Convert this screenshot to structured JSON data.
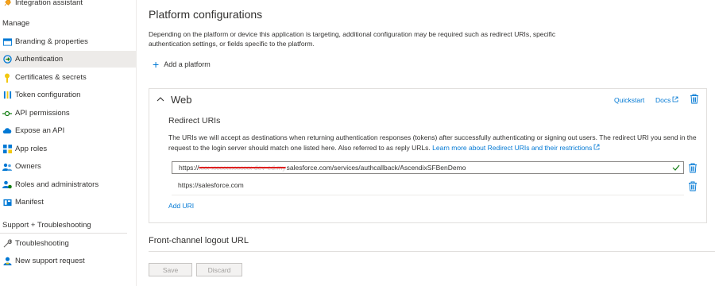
{
  "sidebar": {
    "top_item": {
      "label": "Integration assistant",
      "icon": "rocket-icon"
    },
    "manage_heading": "Manage",
    "manage_items": [
      {
        "label": "Branding & properties",
        "icon": "branding-icon"
      },
      {
        "label": "Authentication",
        "icon": "authentication-icon",
        "active": true
      },
      {
        "label": "Certificates & secrets",
        "icon": "key-icon"
      },
      {
        "label": "Token configuration",
        "icon": "token-icon"
      },
      {
        "label": "API permissions",
        "icon": "api-permissions-icon"
      },
      {
        "label": "Expose an API",
        "icon": "cloud-icon"
      },
      {
        "label": "App roles",
        "icon": "app-roles-icon"
      },
      {
        "label": "Owners",
        "icon": "owners-icon"
      },
      {
        "label": "Roles and administrators",
        "icon": "roles-icon"
      },
      {
        "label": "Manifest",
        "icon": "manifest-icon"
      }
    ],
    "support_heading": "Support + Troubleshooting",
    "support_items": [
      {
        "label": "Troubleshooting",
        "icon": "wrench-icon"
      },
      {
        "label": "New support request",
        "icon": "support-person-icon"
      }
    ]
  },
  "main": {
    "title": "Platform configurations",
    "description": "Depending on the platform or device this application is targeting, additional configuration may be required such as redirect URIs, specific authentication settings, or fields specific to the platform.",
    "add_platform_label": "Add a platform",
    "web_card": {
      "title": "Web",
      "quickstart_label": "Quickstart",
      "docs_label": "Docs",
      "redirect_title": "Redirect URIs",
      "redirect_desc": "The URIs we will accept as destinations when returning authentication responses (tokens) after successfully authenticating or signing out users. The redirect URI you send in the request to the login server should match one listed here. Also referred to as reply URLs. ",
      "learn_more_label": "Learn more about Redirect URIs and their restrictions",
      "uri_input": {
        "prefix": "https://",
        "redacted": "xxx-xxxxxxxxxxxx-dev-ed.my",
        "suffix": "salesforce.com/services/authcallback/AscendixSFBenDemo"
      },
      "uris": [
        "https://salesforce.com"
      ],
      "add_uri_label": "Add URI"
    },
    "front_channel_title": "Front-channel logout URL",
    "save_label": "Save",
    "discard_label": "Discard"
  },
  "colors": {
    "accent": "#0078d4",
    "check": "#107c10",
    "active_bg": "#edebe9",
    "redaction": "#e02020"
  }
}
